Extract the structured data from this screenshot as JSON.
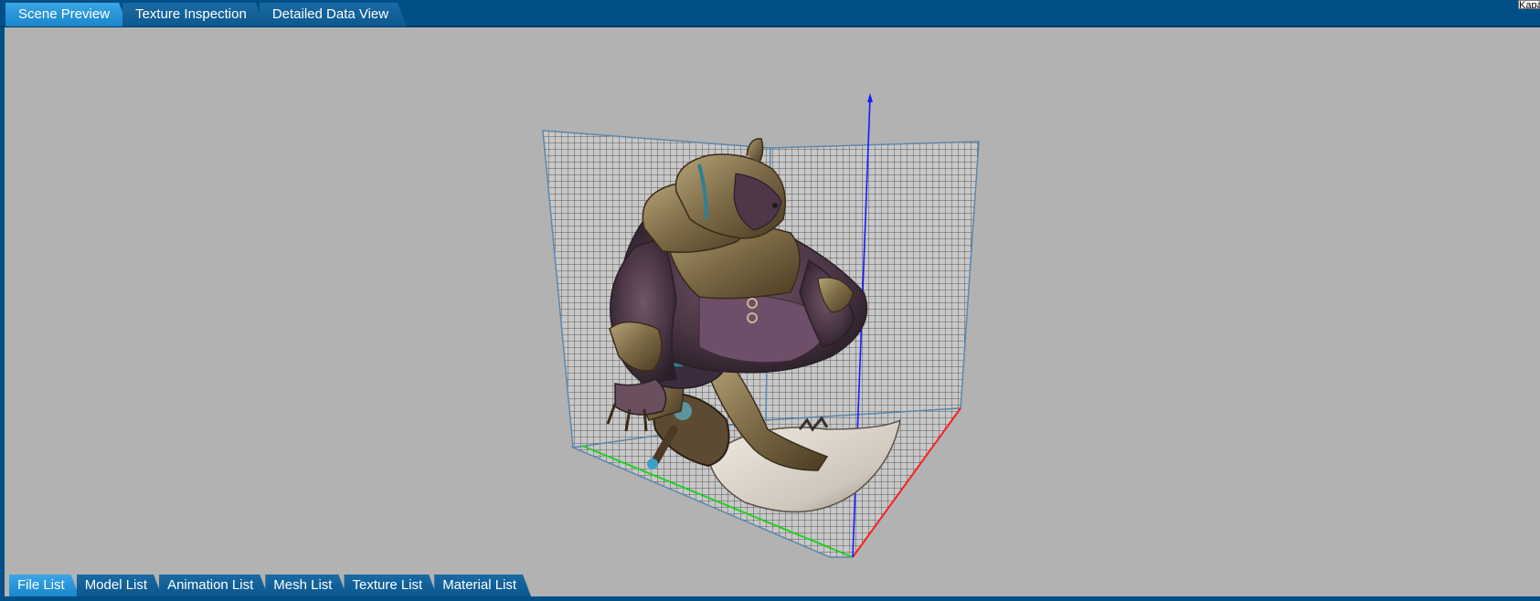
{
  "top_tabs": [
    {
      "label": "Scene Preview",
      "active": true
    },
    {
      "label": "Texture Inspection",
      "active": false
    },
    {
      "label": "Detailed Data View",
      "active": false
    }
  ],
  "corner_label": "Kapa",
  "bottom_tabs": [
    {
      "label": "File List",
      "active": true
    },
    {
      "label": "Model List",
      "active": false
    },
    {
      "label": "Animation List",
      "active": false
    },
    {
      "label": "Mesh List",
      "active": false
    },
    {
      "label": "Texture List",
      "active": false
    },
    {
      "label": "Material List",
      "active": false
    }
  ],
  "colors": {
    "frame": "#004f87",
    "tab_active": "#2a96dc",
    "tab_inactive": "#145f98",
    "viewport_bg": "#b2b2b2",
    "axis_x": "#ff2020",
    "axis_y": "#20d020",
    "axis_z": "#1a1aff",
    "grid": "#3a3a3a"
  },
  "viewport": {
    "content": "3d-character-model",
    "icons": [
      "grid-box-icon",
      "axis-gizmo-icon"
    ]
  }
}
